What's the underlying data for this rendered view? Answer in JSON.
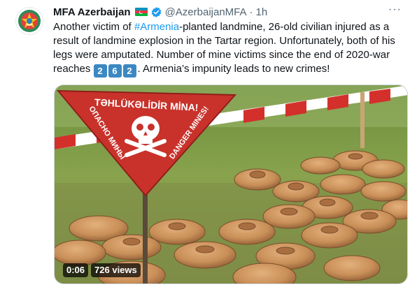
{
  "tweet": {
    "author_name": "MFA Azerbaijan",
    "author_flag_icon": "azerbaijan-flag-icon",
    "verified_icon": "verified-badge-icon",
    "handle": "@AzerbaijanMFA",
    "separator": "·",
    "time": "1h",
    "more_icon": "more-options-icon",
    "text_part1": "Another victim of ",
    "hashtag": "#Armenia",
    "text_part2": "-planted landmine, 26-old civilian injured as a result of landmine explosion in the Tartar region. Unfortunately, both of his legs were amputated. Number of mine victims since the end of 2020-war reaches ",
    "keycap_1": "2",
    "keycap_2": "6",
    "keycap_3": "2",
    "text_part3": ". Armenia’s impunity leads to new crimes!"
  },
  "media": {
    "sign_line1": "TƏHLÜKƏLİDİR MİNA!",
    "sign_line2": "ОПАСНО МИНЫ",
    "sign_line3": "DANGER MINES!",
    "duration": "0:06",
    "views": "726 views"
  },
  "colors": {
    "accent": "#1d9bf0",
    "text": "#0f1419",
    "secondary_text": "#536471",
    "keycap": "#3b88c3",
    "warning_red": "#c8322b"
  }
}
